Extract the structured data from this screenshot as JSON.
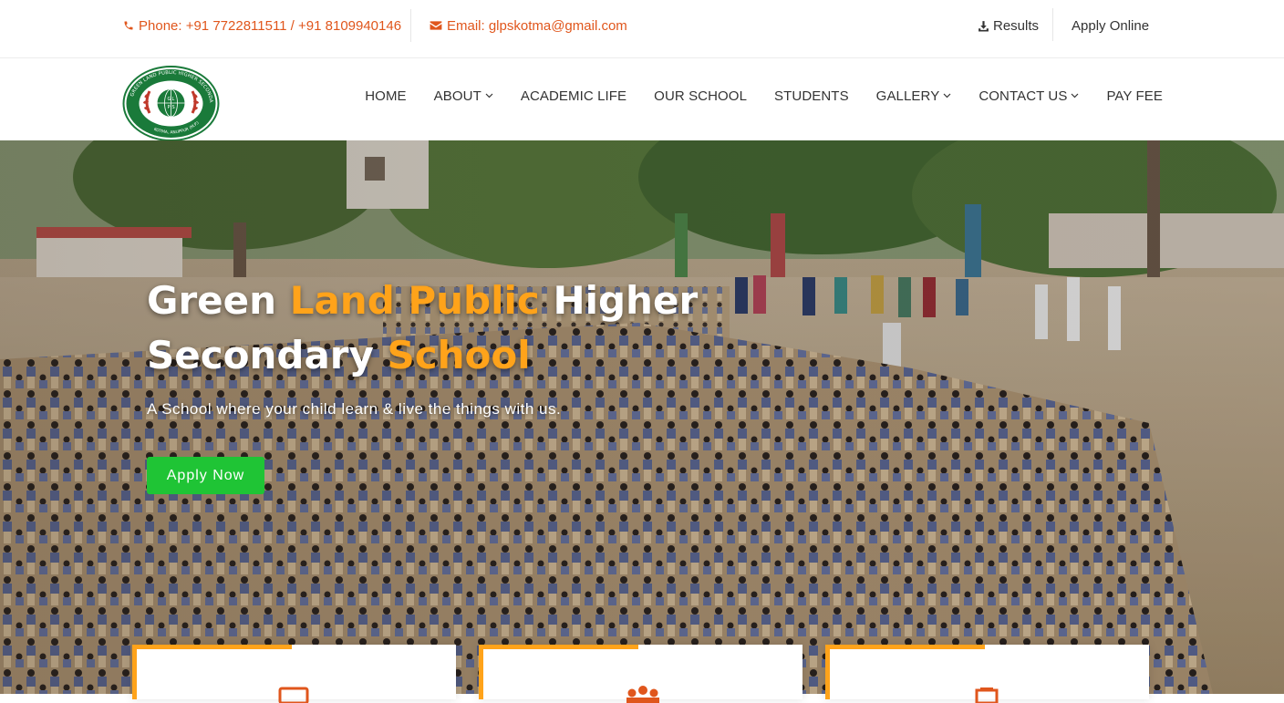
{
  "topbar": {
    "phone": "Phone: +91 7722811511 / +91 8109940146",
    "email": "Email: glpskotma@gmail.com",
    "results_label": "Results",
    "apply_online_label": "Apply Online"
  },
  "logo": {
    "ring_text_top": "GREEN LAND PUBLIC HIGHER SECONDARY SCHOOL",
    "ring_text_bottom": "KOTMA, ANUPPUR (M.P.)",
    "center_letters": [
      "G",
      "L",
      "P",
      "S"
    ]
  },
  "nav": {
    "items": [
      {
        "label": "HOME",
        "dropdown": false
      },
      {
        "label": "ABOUT",
        "dropdown": true
      },
      {
        "label": "ACADEMIC LIFE",
        "dropdown": false
      },
      {
        "label": "OUR SCHOOL",
        "dropdown": false
      },
      {
        "label": "STUDENTS",
        "dropdown": false
      },
      {
        "label": "GALLERY",
        "dropdown": true
      },
      {
        "label": "CONTACT US",
        "dropdown": true
      },
      {
        "label": "PAY FEE",
        "dropdown": false
      }
    ]
  },
  "hero": {
    "title_part1": "Green ",
    "title_accent1": "Land Public",
    "title_part2": " Higher",
    "title_part3": "Secondary ",
    "title_accent2": "School",
    "subtitle": "A School where your child learn & live the things with us.",
    "button_label": "Apply Now"
  },
  "cards": [
    {
      "icon": "book-icon"
    },
    {
      "icon": "group-icon"
    },
    {
      "icon": "certificate-icon"
    }
  ],
  "colors": {
    "accent_orange": "#ffa31a",
    "contact_orange": "#e0561c",
    "button_green": "#1fc435",
    "logo_green": "#1a7a3a",
    "logo_red": "#c0392b"
  }
}
